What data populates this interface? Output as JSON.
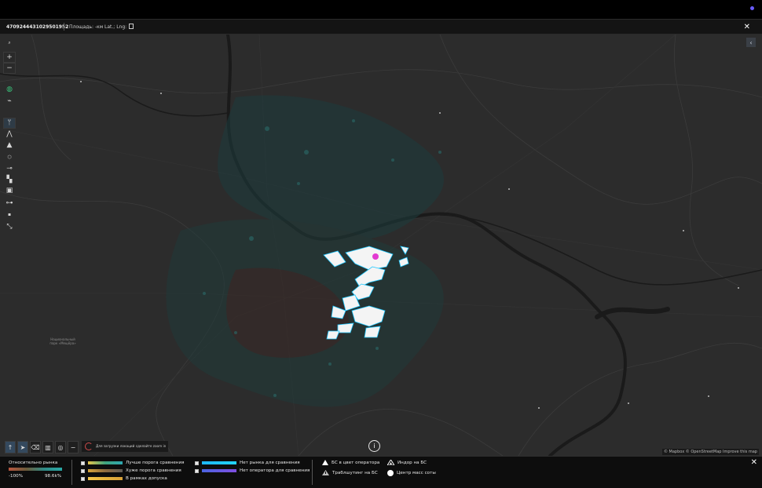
{
  "header": {
    "id": "4709244431029501952",
    "area": "Площадь: -км",
    "latlng": "Lat.; Lng:"
  },
  "map": {
    "place_label_line1": "Национальный",
    "place_label_line2": "парк «Мещёра»",
    "hint": "Для загрузки локаций сделайте zoom in",
    "attribution": "© Mapbox © OpenStreetMap  Improve this map"
  },
  "legend": {
    "title": "Относительно рынка",
    "min": "-100%",
    "max": "98.6k%",
    "items_col1": [
      {
        "label": "Лучше порога сравнения"
      },
      {
        "label": "Хуже порога сравнения"
      },
      {
        "label": "В рамках допуска"
      }
    ],
    "items_col2": [
      {
        "label": "Нет рынка для сравнения"
      },
      {
        "label": "Нет оператора для сравнения"
      }
    ],
    "symbols": [
      {
        "label": "БС в цвет оператора"
      },
      {
        "label": "Индор на БС"
      },
      {
        "label": "Траблшутинг на БС"
      },
      {
        "label": "Центр масс соты"
      }
    ]
  },
  "colors": {
    "map_bg": "#2c2c2c",
    "accent_cyan": "#1ec8ff",
    "accent_purple": "#6a5cff"
  }
}
